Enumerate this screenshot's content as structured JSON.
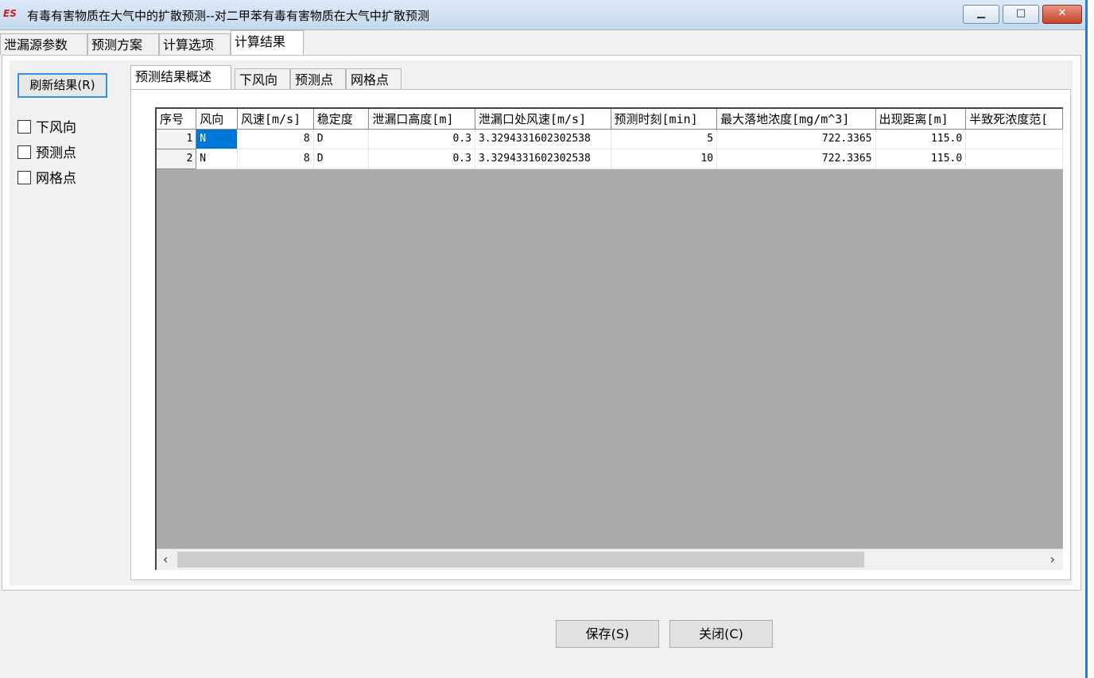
{
  "window": {
    "title": "有毒有害物质在大气中的扩散预测--对二甲苯有毒有害物质在大气中扩散预测",
    "icon_text": "ES",
    "controls": [
      "minimize-icon",
      "maximize-icon",
      "close-icon"
    ]
  },
  "main_tabs": [
    {
      "label": "泄漏源参数"
    },
    {
      "label": "预测方案"
    },
    {
      "label": "计算选项"
    },
    {
      "label": "计算结果",
      "active": true
    }
  ],
  "left_panel": {
    "refresh_label": "刷新结果(R)",
    "checkboxes": [
      {
        "label": "下风向",
        "checked": false
      },
      {
        "label": "预测点",
        "checked": false
      },
      {
        "label": "网格点",
        "checked": false
      }
    ]
  },
  "sub_tabs": [
    {
      "label": "预测结果概述",
      "active": true
    },
    {
      "label": "下风向"
    },
    {
      "label": "预测点"
    },
    {
      "label": "网格点"
    }
  ],
  "table": {
    "columns": [
      "序号",
      "风向",
      "风速[m/s]",
      "稳定度",
      "泄漏口高度[m]",
      "泄漏口处风速[m/s]",
      "预测时刻[min]",
      "最大落地浓度[mg/m^3]",
      "出现距离[m]",
      "半致死浓度范["
    ],
    "rows": [
      [
        "1",
        "N",
        "8",
        "D",
        "0.3",
        "3.3294331602302538",
        "5",
        "722.3365",
        "115.0",
        ""
      ],
      [
        "2",
        "N",
        "8",
        "D",
        "0.3",
        "3.3294331602302538",
        "10",
        "722.3365",
        "115.0",
        ""
      ]
    ],
    "selected_cell": {
      "row": 0,
      "col": 1
    },
    "scroll_left_icon": "‹",
    "scroll_right_icon": "›"
  },
  "footer": {
    "save_label": "保存(S)",
    "close_label": "关闭(C)"
  },
  "colors": {
    "selection": "#0078d7",
    "focus_border": "#3a8ee6",
    "grid_empty": "#ababab",
    "close_button": "#c4432a"
  }
}
